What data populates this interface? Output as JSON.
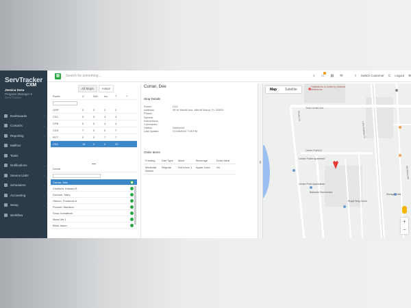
{
  "app": {
    "logo_primary": "ServTracker",
    "logo_secondary": "CXM",
    "user_name": "Jessica Sosa",
    "user_role": "Program Manager ▾",
    "user_org": "ServTracker"
  },
  "sidebar": {
    "items": [
      {
        "label": "Dashboards",
        "icon": "dashboard-icon",
        "chevron": "‹"
      },
      {
        "label": "Contacts",
        "icon": "contacts-icon",
        "chevron": "‹"
      },
      {
        "label": "Reporting",
        "icon": "reporting-icon",
        "chevron": "‹"
      },
      {
        "label": "Mailbox",
        "icon": "mailbox-icon",
        "chevron": ""
      },
      {
        "label": "Tasks",
        "icon": "tasks-icon",
        "chevron": ""
      },
      {
        "label": "Notifications",
        "icon": "notifications-icon",
        "chevron": "‹"
      },
      {
        "label": "Service Units",
        "icon": "service-units-icon",
        "chevron": "‹"
      },
      {
        "label": "Schedulers",
        "icon": "schedulers-icon",
        "chevron": "‹"
      },
      {
        "label": "Accounting",
        "icon": "accounting-icon",
        "chevron": "‹"
      },
      {
        "label": "Setup",
        "icon": "setup-icon",
        "chevron": "‹"
      },
      {
        "label": "Workflow",
        "icon": "workflow-icon",
        "chevron": ""
      }
    ]
  },
  "topbar": {
    "search_placeholder": "Search for something...",
    "switch_customer": "Switch Customer",
    "logout": "Logout"
  },
  "routes": {
    "tab_all": "All Stops",
    "tab_active": "Active",
    "headers": [
      "Route",
      "C",
      "N/D",
      "Inc",
      "T",
      "?"
    ],
    "rows": [
      [
        "GHP",
        "0",
        "0",
        "2",
        "2",
        ""
      ],
      [
        "CD1",
        "0",
        "0",
        "4",
        "4",
        ""
      ],
      [
        "CPB",
        "0",
        "0",
        "4",
        "4",
        ""
      ],
      [
        "CD3",
        "7",
        "0",
        "0",
        "7",
        ""
      ],
      [
        "RCT",
        "0",
        "0",
        "7",
        "7",
        ""
      ],
      [
        "CD1",
        "16",
        "2",
        "2",
        "20",
        ""
      ]
    ]
  },
  "list": {
    "header": "Linear",
    "items": [
      "Curran, Dee",
      "Chatfield, Edward R",
      "Durham, Mary",
      "Gibson, Frederick A",
      "Prosser, Madison",
      "Sosa Jonnathan",
      "Mear Ute 1",
      "Blaid Jason"
    ]
  },
  "detail": {
    "title": "Curran, Dee",
    "stop_details": "Stop Details",
    "fields": [
      {
        "k": "Route:",
        "v": "CD1"
      },
      {
        "k": "Address:",
        "v": "55 W Merritt Ave, Merritt Island, FL 32953"
      },
      {
        "k": "Phone:",
        "v": ""
      },
      {
        "k": "Special",
        "v": ""
      },
      {
        "k": "Instructions:",
        "v": ""
      },
      {
        "k": "Comments:",
        "v": ""
      },
      {
        "k": "Status:",
        "v": "Delivered"
      },
      {
        "k": "Last Update:",
        "v": "07/18/2022 7:09 PM"
      }
    ],
    "order_items": "Order Items",
    "order_headers": [
      "Funding",
      "Diet Type",
      "Meal",
      "Beverage",
      "Extra Meal"
    ],
    "order_rows": [
      [
        "Medicaid Waiver",
        "Regular",
        "Hot lunch 1",
        "Apple Juice",
        "No"
      ]
    ]
  },
  "map": {
    "tab_map": "Map",
    "tab_satellite": "Satellite",
    "labels": {
      "poi1": "Fairfield Inn & Suites by Marriott Melbourne",
      "poi2": "Centre Pointe Apartment",
      "poi3": "Centre Point Apartments",
      "poi4": "Ballanda Townhomes",
      "poi5": "Royal Teriy Grove",
      "poi6": "Storage Units",
      "street1": "Town Center Ave",
      "street2": "Centre Point Dr",
      "street3": "Lake Andrew Dr",
      "street4": "Rodeo Dr",
      "street5": "Wickham Rd"
    },
    "zoom_in": "+",
    "zoom_out": "−"
  }
}
